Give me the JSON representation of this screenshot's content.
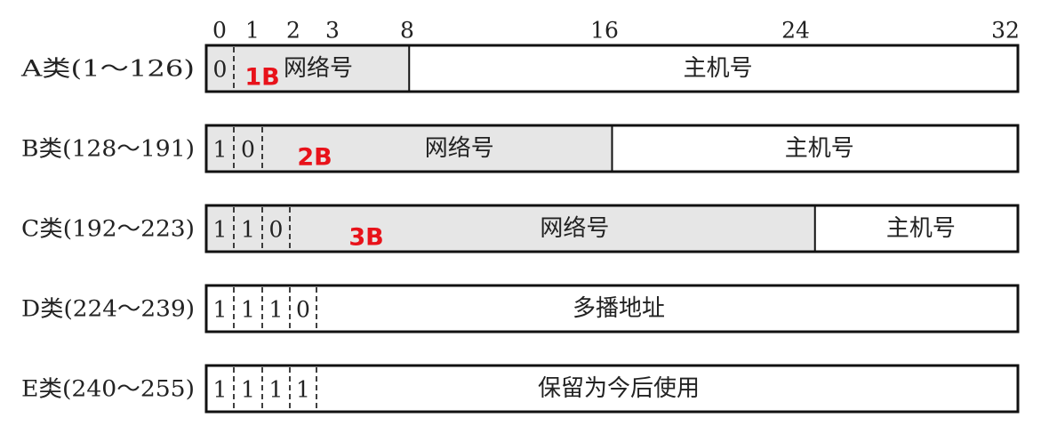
{
  "bit_scale": [
    "0",
    "1",
    "2",
    "3",
    "8",
    "16",
    "24",
    "32"
  ],
  "classes": [
    {
      "label": "A类(1～126)",
      "bits": [
        "0"
      ],
      "network": "网络号",
      "host": "主机号",
      "annotation": "1B",
      "network_end_bit": 8
    },
    {
      "label": "B类(128～191)",
      "bits": [
        "1",
        "0"
      ],
      "network": "网络号",
      "host": "主机号",
      "annotation": "2B",
      "network_end_bit": 16
    },
    {
      "label": "C类(192～223)",
      "bits": [
        "1",
        "1",
        "0"
      ],
      "network": "网络号",
      "host": "主机号",
      "annotation": "3B",
      "network_end_bit": 24
    },
    {
      "label": "D类(224～239)",
      "bits": [
        "1",
        "1",
        "1",
        "0"
      ],
      "address": "多播地址"
    },
    {
      "label": "E类(240～255)",
      "bits": [
        "1",
        "1",
        "1",
        "1"
      ],
      "address": "保留为今后使用"
    }
  ],
  "colors": {
    "network_fill": "#e6e6e6",
    "box_fill": "#ffffff",
    "stroke": "#111111",
    "annotation": "#e8121a"
  }
}
